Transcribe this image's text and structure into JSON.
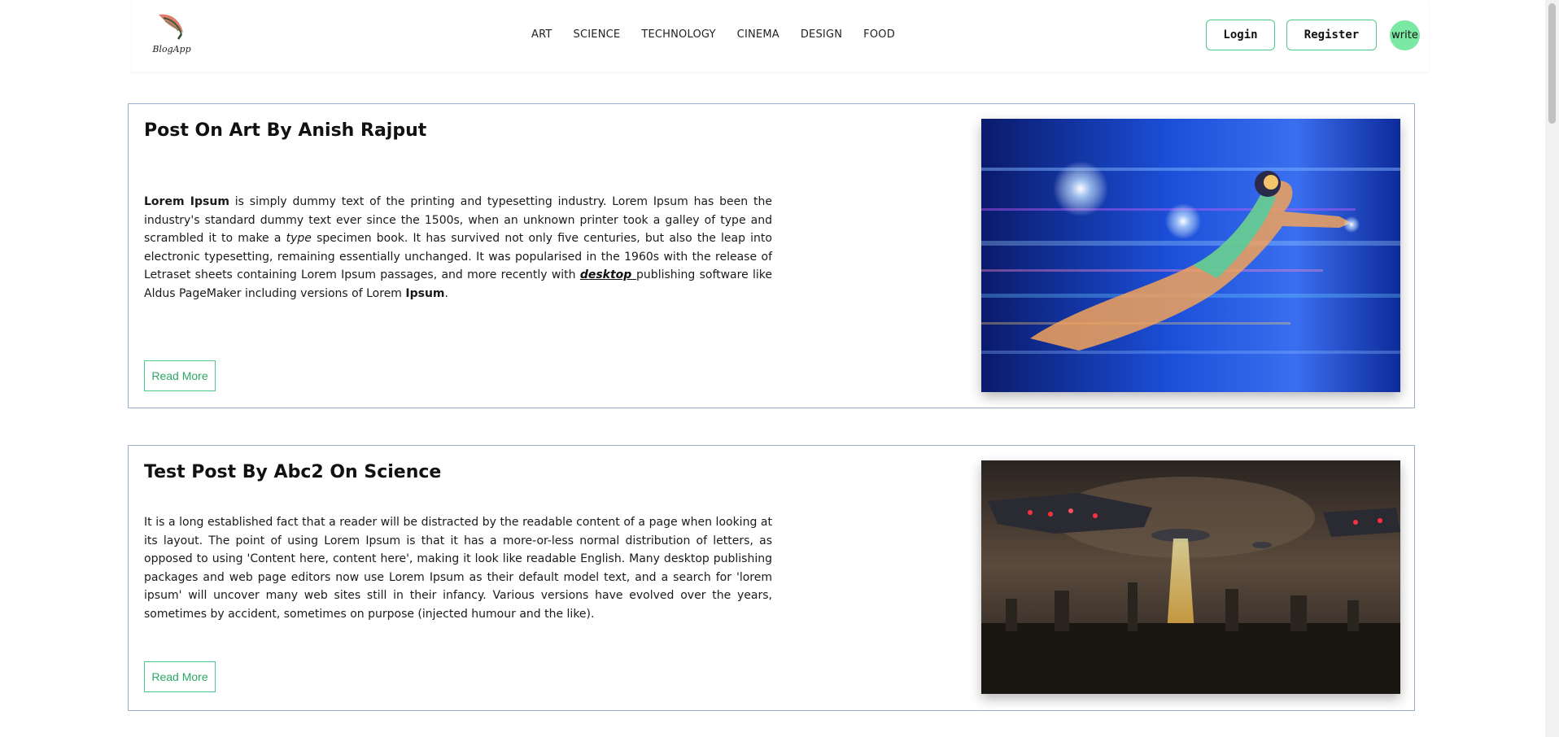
{
  "brand": {
    "name": "BlogApp",
    "logo_icon": "feather-quill-icon"
  },
  "nav": {
    "links": [
      "ART",
      "SCIENCE",
      "TECHNOLOGY",
      "CINEMA",
      "DESIGN",
      "FOOD"
    ],
    "login_label": "Login",
    "register_label": "Register",
    "write_label": "write"
  },
  "colors": {
    "accent_green": "#4cc98a",
    "write_badge": "#7be8a3",
    "card_border": "#9aaed0"
  },
  "posts": [
    {
      "title": "Post On Art By Anish Rajput",
      "body": {
        "bold_start": "Lorem Ipsum",
        "text_1": " is simply dummy text of the printing and typesetting industry. Lorem Ipsum has been the industry's standard dummy text ever since the 1500s, when an unknown printer took a galley of type and scrambled it to make a ",
        "italic_word": "type",
        "text_2": " specimen book. It has survived not only five centuries, but also the leap into electronic typesetting, remaining essentially unchanged. It was popularised in the 1960s with the release of Letraset sheets containing Lorem Ipsum passages, and more recently with ",
        "link_word": "desktop ",
        "text_3": "publishing software like Aldus PageMaker including versions of Lorem ",
        "bold_end": "Ipsum",
        "text_4": "."
      },
      "read_more_label": "Read More",
      "image_icon": "superhero-flying-art-image"
    },
    {
      "title": "Test Post By Abc2 On Science",
      "body_text": "It is a long established fact that a reader will be distracted by the readable content of a page when looking at its layout. The point of using Lorem Ipsum is that it has a more-or-less normal distribution of letters, as opposed to using 'Content here, content here', making it look like readable English. Many desktop publishing packages and web page editors now use Lorem Ipsum as their default model text, and a search for 'lorem ipsum' will uncover many web sites still in their infancy. Various versions have evolved over the years, sometimes by accident, sometimes on purpose (injected humour and the like).",
      "read_more_label": "Read More",
      "image_icon": "alien-spaceships-city-image"
    }
  ]
}
